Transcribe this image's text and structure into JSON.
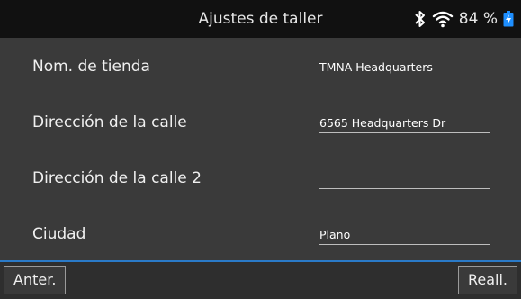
{
  "header": {
    "title": "Ajustes de taller",
    "battery_percent": "84 %",
    "icons": [
      "bluetooth-icon",
      "wifi-icon",
      "battery-charging-icon"
    ]
  },
  "fields": [
    {
      "label": "Nom. de tienda",
      "value": "TMNA Headquarters"
    },
    {
      "label": "Dirección de la calle",
      "value": "6565 Headquarters Dr"
    },
    {
      "label": "Dirección de la calle 2",
      "value": ""
    },
    {
      "label": "Ciudad",
      "value": "Plano"
    }
  ],
  "footer": {
    "prev_label": "Anter.",
    "done_label": "Reali."
  },
  "colors": {
    "accent": "#2a7ac8",
    "battery": "#1e8fff"
  }
}
